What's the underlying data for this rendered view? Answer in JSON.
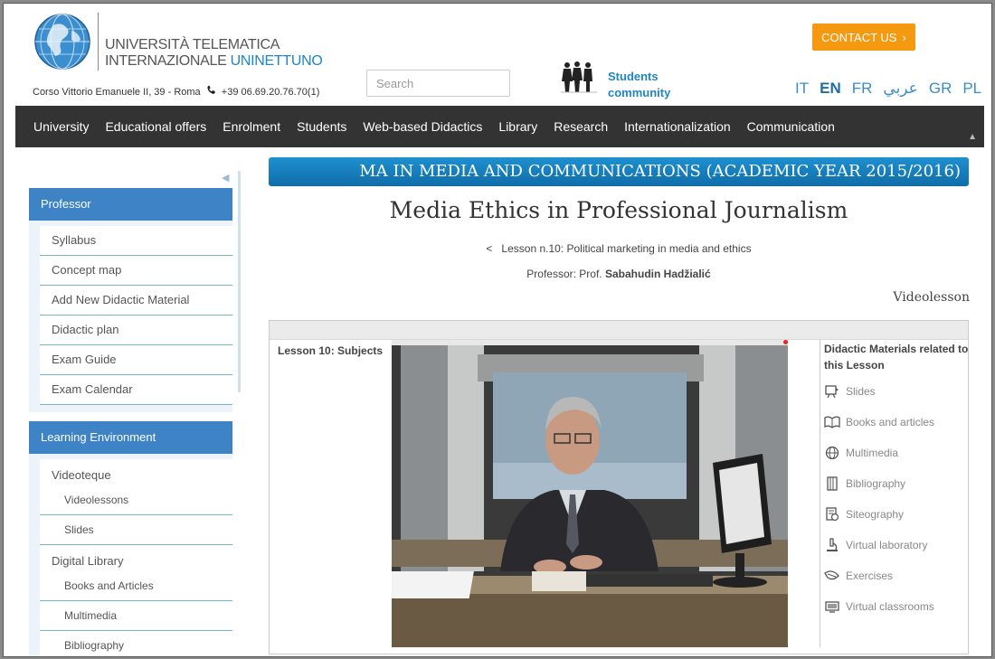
{
  "header": {
    "logo_line1": "UNIVERSITÀ TELEMATICA",
    "logo_line2_part1": "INTERNAZIONALE ",
    "logo_line2_part2": "UNINETTUNO",
    "address": "Corso Vittorio Emanuele II, 39 - Roma",
    "phone": "+39 06.69.20.76.70(1)",
    "search_placeholder": "Search",
    "students_line1": "Students",
    "students_line2": "community",
    "contact_label": "CONTACT US",
    "contact_chevron": "›",
    "languages": [
      "IT",
      "EN",
      "FR",
      "عربي",
      "GR",
      "PL"
    ],
    "active_language": "EN"
  },
  "nav": {
    "items": [
      "University",
      "Educational offers",
      "Enrolment",
      "Students",
      "Web-based Didactics",
      "Library",
      "Research",
      "Internationalization",
      "Communication"
    ]
  },
  "sidebar": {
    "professor_header": "Professor",
    "professor_items": [
      "Syllabus",
      "Concept map",
      "Add New Didactic Material",
      "Didactic plan",
      "Exam Guide",
      "Exam Calendar"
    ],
    "learning_header": "Learning Environment",
    "videoteque": "Videoteque",
    "videoteque_items": [
      "Videolessons",
      "Slides"
    ],
    "digital_library": "Digital Library",
    "library_items": [
      "Books and Articles",
      "Multimedia",
      "Bibliography"
    ]
  },
  "main": {
    "banner": "MA IN MEDIA AND COMMUNICATIONS (ACADEMIC YEAR 2015/2016)",
    "course_title": "Media Ethics in Professional Journalism",
    "lesson_back": "<",
    "lesson_line": "Lesson n.10: Political marketing in media and ethics",
    "professor_prefix": "Professor: Prof.",
    "professor_name": "Sabahudin Hadžialić",
    "videolesson_label": "Videolesson",
    "lesson_subjects": "Lesson 10: Subjects",
    "materials_title": "Didactic Materials related to this Lesson",
    "materials": [
      {
        "label": "Slides",
        "icon": "slides-icon"
      },
      {
        "label": "Books and articles",
        "icon": "book-icon"
      },
      {
        "label": "Multimedia",
        "icon": "globe-icon"
      },
      {
        "label": "Bibliography",
        "icon": "bibliography-icon"
      },
      {
        "label": "Siteography",
        "icon": "siteography-icon"
      },
      {
        "label": "Virtual laboratory",
        "icon": "microscope-icon"
      },
      {
        "label": "Exercises",
        "icon": "exercises-icon"
      },
      {
        "label": "Virtual classrooms",
        "icon": "classroom-icon"
      }
    ]
  },
  "colors": {
    "accent_blue": "#1e86c5",
    "nav_bg": "#333333",
    "contact_orange": "#f59a10",
    "sidebar_header": "#3d83c6"
  }
}
